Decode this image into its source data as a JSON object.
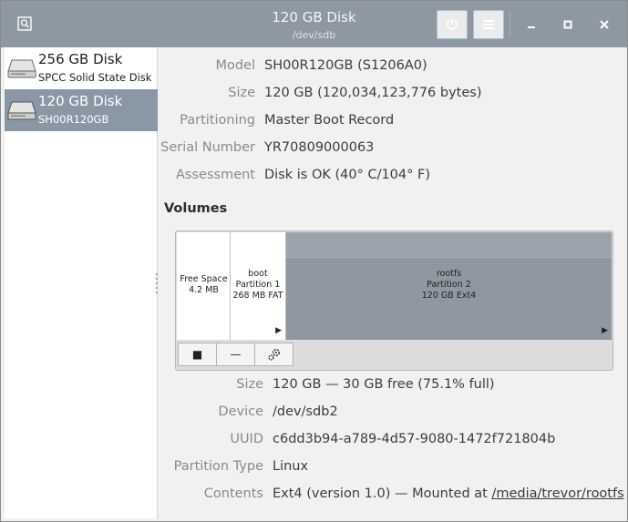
{
  "window": {
    "title": "120 GB Disk",
    "subtitle": "/dev/sdb"
  },
  "titlebar": {
    "power_icon": "power-icon",
    "menu_icon": "hamburger-menu-icon",
    "minimize": "–",
    "maximize": "□",
    "close": "✕"
  },
  "sidebar": {
    "items": [
      {
        "title": "256 GB Disk",
        "subtitle": "SPCC Solid State Disk",
        "icon": "drive-icon",
        "selected": false
      },
      {
        "title": "120 GB Disk",
        "subtitle": "SH00R120GB",
        "icon": "drive-icon",
        "selected": true
      }
    ]
  },
  "disk": {
    "labels": {
      "model": "Model",
      "size": "Size",
      "partitioning": "Partitioning",
      "serial": "Serial Number",
      "assessment": "Assessment"
    },
    "values": {
      "model": "SH00R120GB (S1206A0)",
      "size": "120 GB (120,034,123,776 bytes)",
      "partitioning": "Master Boot Record",
      "serial": "YR70809000063",
      "assessment": "Disk is OK (40° C/104° F)"
    }
  },
  "volumes": {
    "heading": "Volumes",
    "segments": [
      {
        "line1": "Free Space",
        "line2": "4.2 MB",
        "line3": ""
      },
      {
        "line1": "boot",
        "line2": "Partition 1",
        "line3": "268 MB FAT"
      },
      {
        "line1": "rootfs",
        "line2": "Partition 2",
        "line3": "120 GB Ext4"
      }
    ],
    "toolbar": {
      "stop_icon": "■",
      "remove_icon": "—",
      "settings_icon": "gear-icon"
    }
  },
  "partition": {
    "labels": {
      "size": "Size",
      "device": "Device",
      "uuid": "UUID",
      "type": "Partition Type",
      "contents": "Contents"
    },
    "values": {
      "size": "120 GB — 30 GB free (75.1% full)",
      "device": "/dev/sdb2",
      "uuid": "c6dd3b94-a789-4d57-9080-1472f721804b",
      "type": "Linux",
      "contents_prefix": "Ext4 (version 1.0) — Mounted at ",
      "mount_path": "/media/trevor/rootfs"
    }
  }
}
